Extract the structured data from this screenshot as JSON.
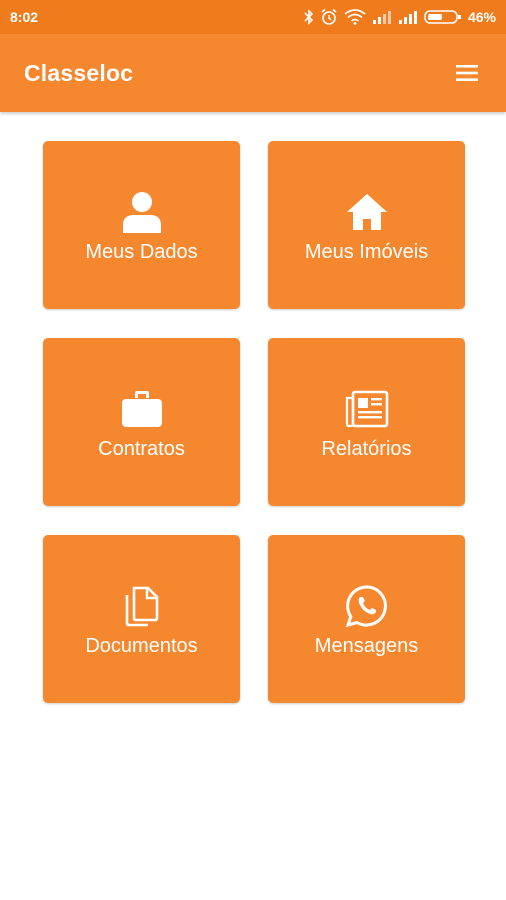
{
  "status_bar": {
    "time": "8:02",
    "battery": "46%",
    "icons": [
      "bluetooth-icon",
      "alarm-icon",
      "wifi-icon",
      "signal-icon",
      "signal-icon",
      "battery-icon"
    ]
  },
  "app_bar": {
    "title": "Classeloc",
    "menu_icon": "hamburger-menu-icon"
  },
  "menu": {
    "tiles": [
      {
        "label": "Meus Dados",
        "icon": "person-icon"
      },
      {
        "label": "Meus Imóveis",
        "icon": "home-icon"
      },
      {
        "label": "Contratos",
        "icon": "briefcase-icon"
      },
      {
        "label": "Relatórios",
        "icon": "newspaper-icon"
      },
      {
        "label": "Documentos",
        "icon": "documents-icon"
      },
      {
        "label": "Mensagens",
        "icon": "whatsapp-icon"
      }
    ]
  },
  "colors": {
    "status_bar": "#f07b1c",
    "app_bar": "#f5882f",
    "tile": "#f5882f",
    "text": "#ffffff",
    "background": "#ffffff"
  }
}
